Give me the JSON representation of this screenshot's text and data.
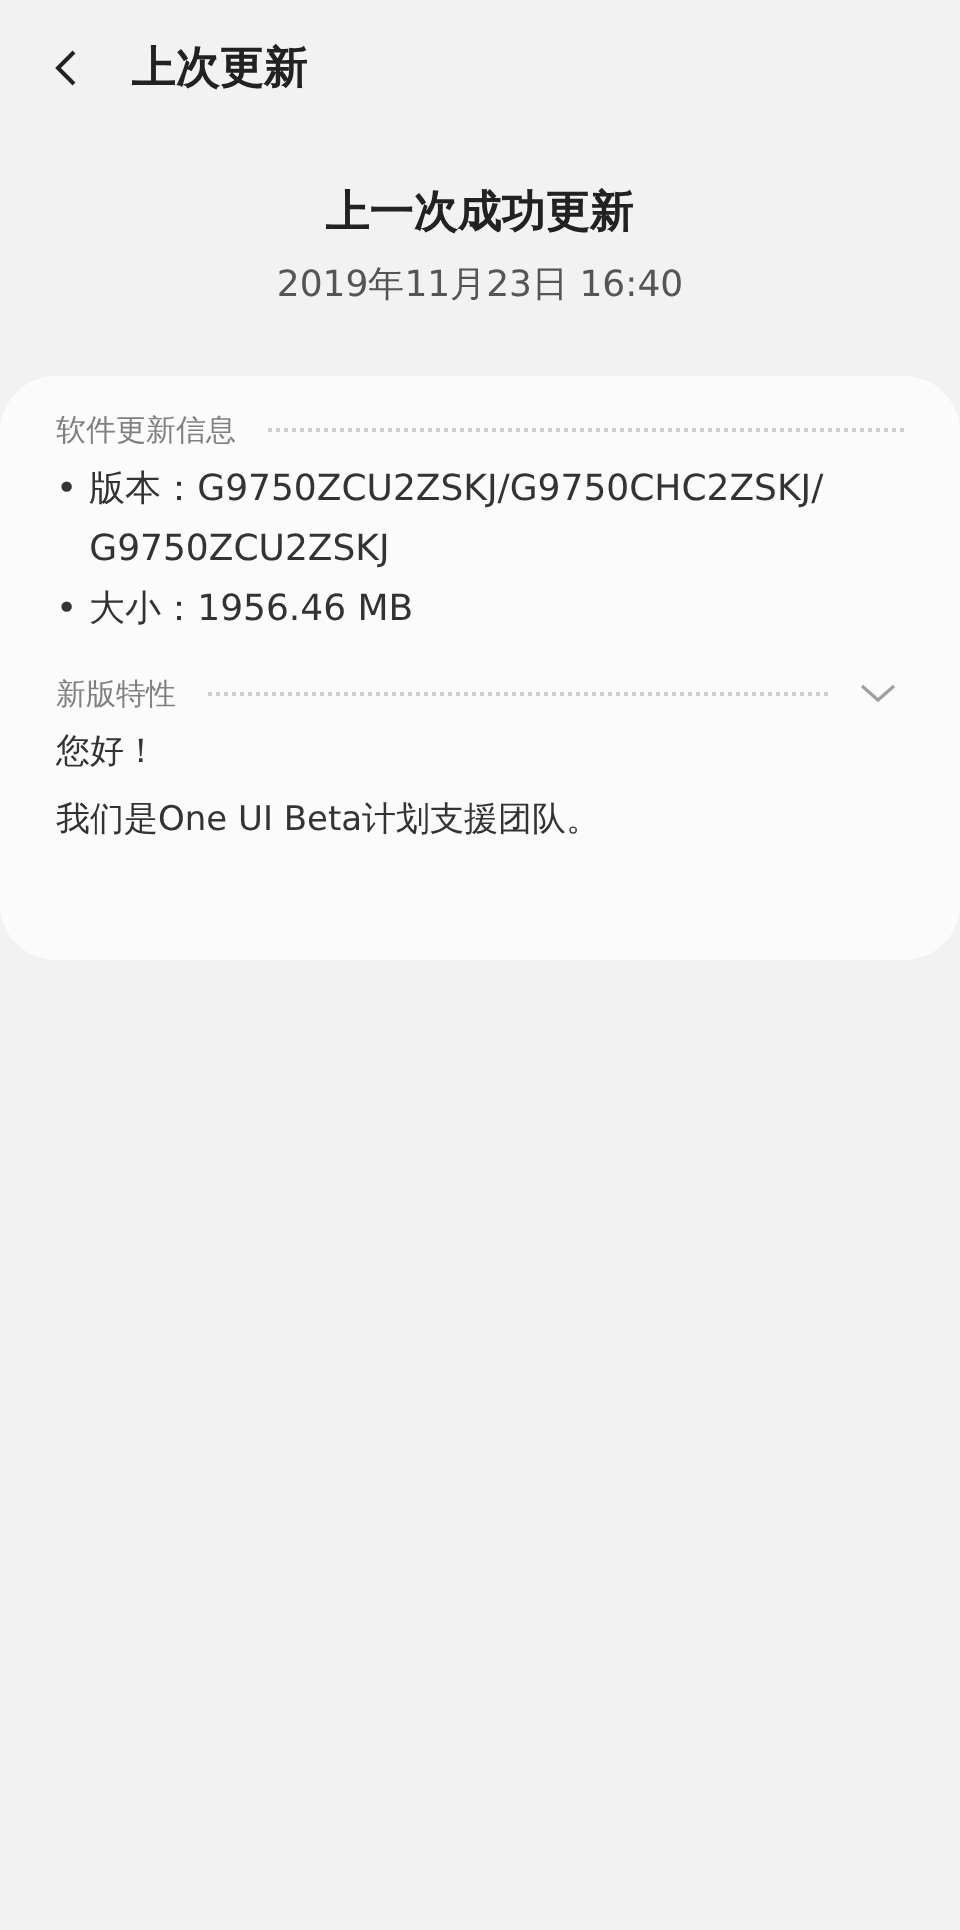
{
  "header": {
    "title": "上次更新"
  },
  "summary": {
    "heading": "上一次成功更新",
    "datetime": "2019年11月23日 16:40"
  },
  "card": {
    "sections": [
      {
        "kind": "info",
        "title": "软件更新信息",
        "items": [
          {
            "bullet": "•",
            "lines": [
              "版本：G9750ZCU2ZSKJ/G9750CHC2ZSKJ/",
              "G9750ZCU2ZSKJ"
            ]
          },
          {
            "bullet": "•",
            "lines": [
              "大小：1956.46 MB"
            ]
          }
        ]
      },
      {
        "kind": "collapsible",
        "title": "新版特性",
        "paragraphs": [
          "您好！",
          "我们是One UI Beta计划支援团队。"
        ]
      }
    ]
  }
}
